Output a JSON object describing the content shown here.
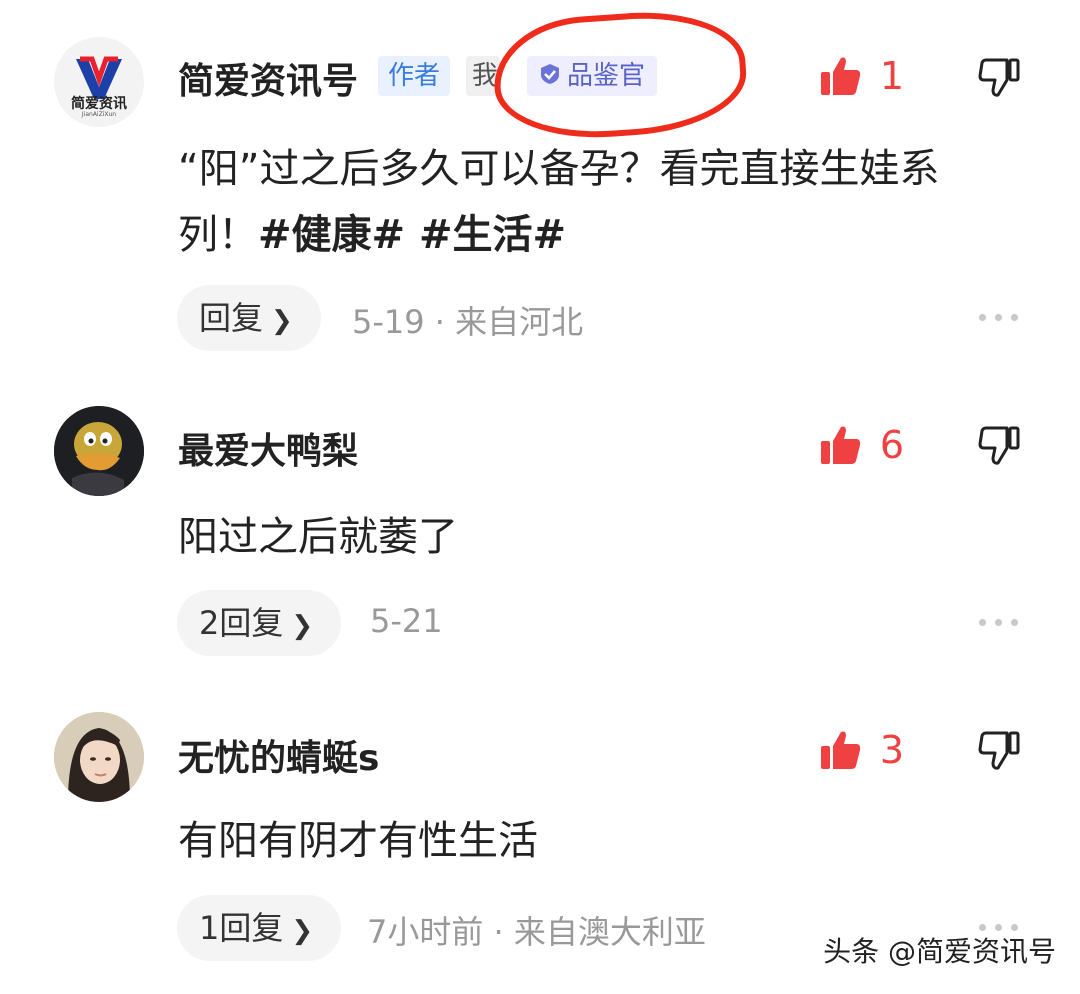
{
  "comments": [
    {
      "username": "简爱资讯号",
      "avatar_logo_text": "简爱资讯",
      "avatar_logo_sub": "JianAiZiXun",
      "tags": {
        "author": "作者",
        "me": "我",
        "judge": "品鉴官"
      },
      "likes": "1",
      "content_text": "“阳”过之后多久可以备孕？看完直接生娃系列！",
      "hashtags": "#健康# #生活#",
      "reply_label": "回复",
      "meta": "5-19 · 来自河北"
    },
    {
      "username": "最爱大鸭梨",
      "likes": "6",
      "content_text": "阳过之后就萎了",
      "reply_label": "2回复",
      "meta": "5-21"
    },
    {
      "username": "无忧的蜻蜓s",
      "likes": "3",
      "content_text": "有阳有阴才有性生活",
      "reply_label": "1回复",
      "meta": "7小时前 · 来自澳大利亚"
    }
  ],
  "watermark": "头条 @简爱资讯号",
  "colors": {
    "like": "#f04142",
    "annotation": "#ef2b1c",
    "author_tag": "#3b7ddd",
    "judge_tag": "#5a63c8"
  },
  "icons": {
    "like": "thumbs-up-icon",
    "dislike": "thumbs-down-icon",
    "more": "more-dots-icon",
    "chevron": "chevron-right-icon",
    "verified": "verified-check-icon"
  }
}
